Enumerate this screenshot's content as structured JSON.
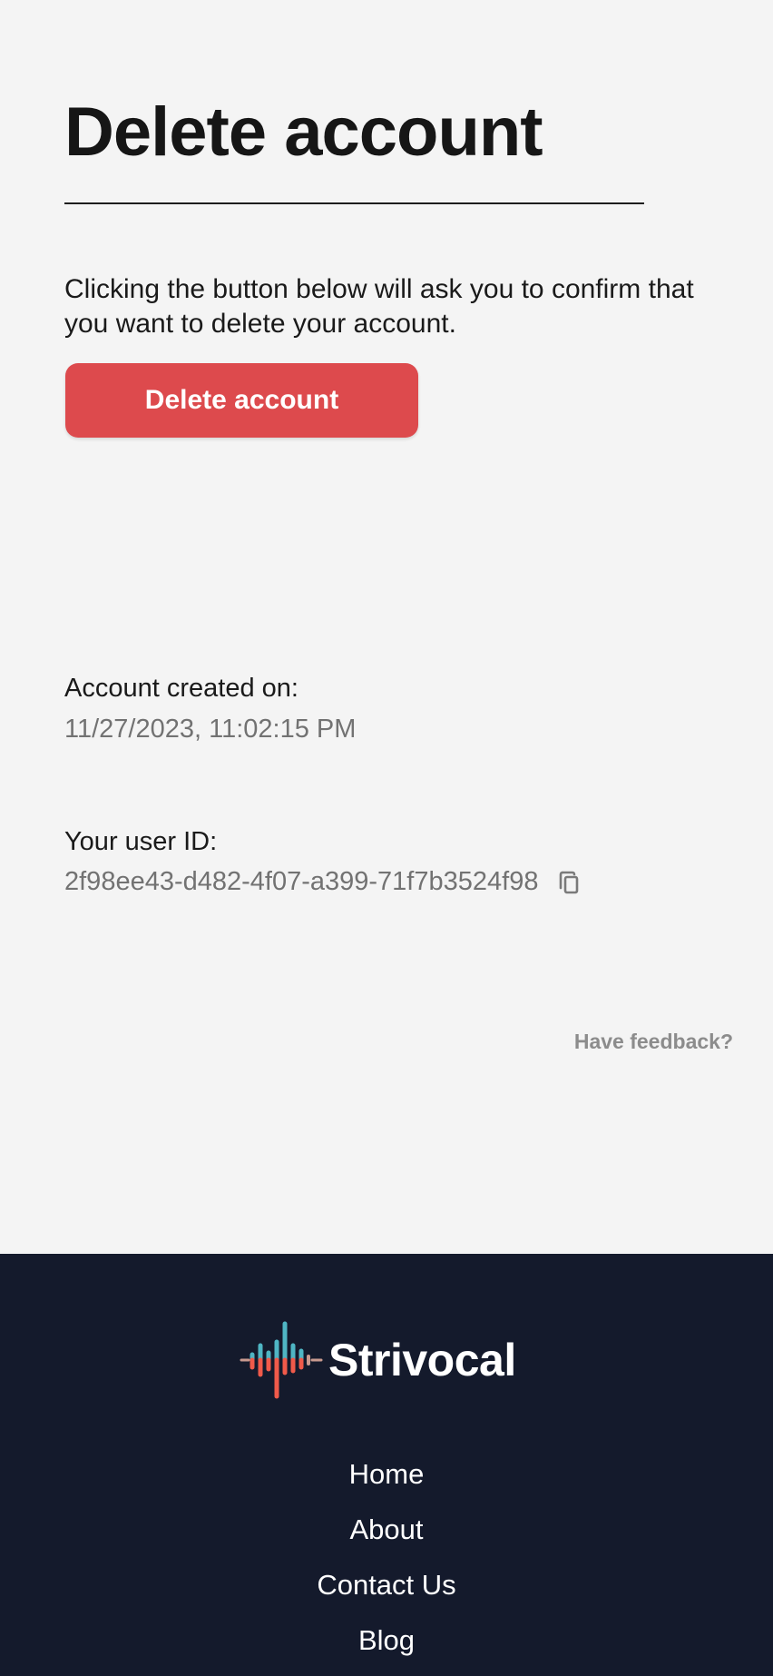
{
  "page": {
    "title": "Delete account",
    "description": "Clicking the button below will ask you to confirm that you want to delete your account.",
    "delete_button_label": "Delete account"
  },
  "account": {
    "created_label": "Account created on:",
    "created_value": "11/27/2023, 11:02:15 PM",
    "user_id_label": "Your user ID:",
    "user_id_value": "2f98ee43-d482-4f07-a399-71f7b3524f98",
    "copy_icon": "copy-icon"
  },
  "feedback_link": "Have feedback?",
  "footer": {
    "brand_name": "Strivocal",
    "logo_icon": "soundwave-logo",
    "nav": [
      "Home",
      "About",
      "Contact Us",
      "Blog"
    ]
  },
  "colors": {
    "background": "#f4f4f4",
    "danger": "#dd4a4d",
    "muted_text": "#727272",
    "footer_background": "#141a2c",
    "logo_teal": "#4fb6c4",
    "logo_red": "#f05a4a"
  }
}
